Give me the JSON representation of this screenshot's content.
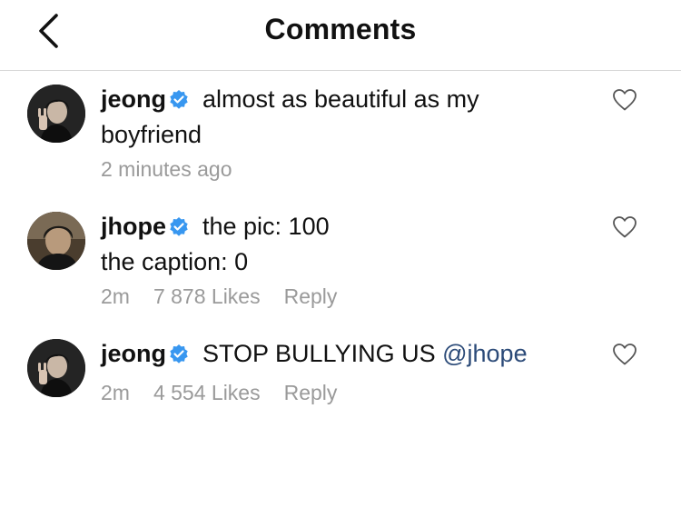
{
  "header": {
    "title": "Comments"
  },
  "comments": [
    {
      "username": "jeong",
      "text": "almost as beautiful as my",
      "text_line2": "boyfriend",
      "time": "2 minutes ago"
    },
    {
      "username": "jhope",
      "text": "the pic: 100",
      "text_line2": "the caption: 0",
      "time": "2m",
      "likes": "7 878 Likes",
      "reply": "Reply"
    },
    {
      "username": "jeong",
      "text": "STOP BULLYING US",
      "mention": "@jhope",
      "time": "2m",
      "likes": "4 554 Likes",
      "reply": "Reply"
    }
  ],
  "colors": {
    "verified_badge": "#3897f0",
    "mention": "#2b4a78",
    "meta_text": "#9a9a9a",
    "divider": "#d6d6d6"
  },
  "icons": [
    "back-arrow-icon",
    "verified-badge-icon",
    "heart-outline-icon"
  ]
}
